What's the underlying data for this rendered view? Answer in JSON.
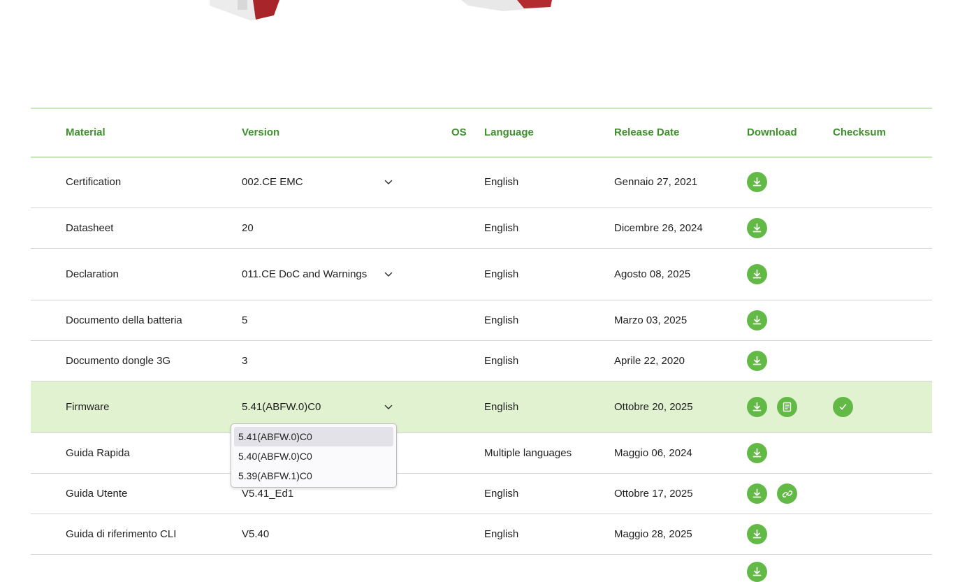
{
  "table": {
    "headers": {
      "material": "Material",
      "version": "Version",
      "os": "OS",
      "language": "Language",
      "release_date": "Release Date",
      "download": "Download",
      "checksum": "Checksum"
    },
    "rows": [
      {
        "material": "Certification",
        "version": "002.CE EMC",
        "language": "English",
        "date": "Gennaio 27, 2021"
      },
      {
        "material": "Datasheet",
        "version": "20",
        "language": "English",
        "date": "Dicembre 26, 2024"
      },
      {
        "material": "Declaration",
        "version": "011.CE DoC and Warnings",
        "language": "English",
        "date": "Agosto 08, 2025"
      },
      {
        "material": "Documento della batteria",
        "version": "5",
        "language": "English",
        "date": "Marzo 03, 2025"
      },
      {
        "material": "Documento dongle 3G",
        "version": "3",
        "language": "English",
        "date": "Aprile 22, 2020"
      },
      {
        "material": "Firmware",
        "version": "5.41(ABFW.0)C0",
        "language": "English",
        "date": "Ottobre 20, 2025"
      },
      {
        "material": "Guida Rapida",
        "version": "",
        "language": "Multiple languages",
        "date": "Maggio 06, 2024"
      },
      {
        "material": "Guida Utente",
        "version": "V5.41_Ed1",
        "language": "English",
        "date": "Ottobre 17, 2025"
      },
      {
        "material": "Guida di riferimento CLI",
        "version": "V5.40",
        "language": "English",
        "date": "Maggio 28, 2025"
      }
    ]
  },
  "firmware_dropdown": {
    "options": [
      "5.41(ABFW.0)C0",
      "5.40(ABFW.0)C0",
      "5.39(ABFW.1)C0"
    ],
    "selected": "5.41(ABFW.0)C0"
  },
  "colors": {
    "accent_green": "#62b946",
    "header_text": "#3f8f2e",
    "highlight_row": "#e0f2cf"
  },
  "icons": {
    "download": "download-icon",
    "release_notes": "release-notes-icon",
    "link": "link-icon",
    "checksum": "checkmark-icon",
    "dropdown": "chevron-down-icon"
  }
}
